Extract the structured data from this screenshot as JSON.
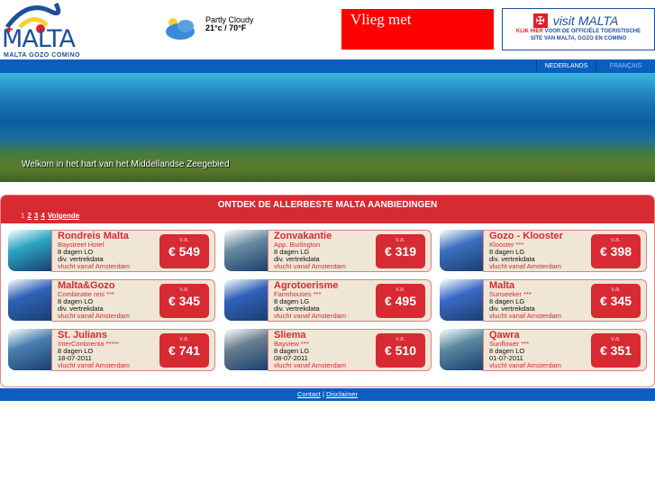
{
  "logo": {
    "word": "MALTA",
    "sub": "MALTA GOZO COMINO"
  },
  "weather": {
    "condition": "Partly Cloudy",
    "temp": "21°c / 70°F"
  },
  "ad": {
    "text": "Vlieg met"
  },
  "visit": {
    "title": "visit MALTA",
    "line1_red": "KLIK HIER",
    "line1": " VOOR DE OFFICIËLE TOERISTISCHE",
    "line2": "SITE VAN MALTA, GOZO EN COMINO"
  },
  "nav": {
    "lang1": "NEDERLANDS",
    "lang2": "FRANÇAIS"
  },
  "hero": {
    "caption": "Welkom in het hart van het Middellandse Zeegebied"
  },
  "panel": {
    "title": "ONTDEK DE ALLERBESTE MALTA AANBIEDINGEN",
    "pager": [
      "1",
      "2",
      "3",
      "4"
    ],
    "next": "Volgende"
  },
  "offers": [
    {
      "title": "Rondreis Malta",
      "hotel": "Baystreet Hotel",
      "l1": "8 dagen LO",
      "l2": "div. vertrekdata",
      "flight": "vlucht vanaf Amsterdam",
      "va": "v.a.",
      "price": "€ 549",
      "img": "#2aa6c4"
    },
    {
      "title": "Zonvakantie",
      "hotel": "App. Burlington",
      "l1": "8 dagen LG",
      "l2": "div. vertrekdata",
      "flight": "vlucht vanaf Amsterdam",
      "va": "v.a.",
      "price": "€ 319",
      "img": "#6a8aa0"
    },
    {
      "title": "Gozo - Klooster",
      "hotel": "Klooster ***",
      "l1": "8 dagen LG",
      "l2": "div. vertrekdata",
      "flight": "vlucht vanaf Amsterdam",
      "va": "v.a.",
      "price": "€ 398",
      "img": "#3a70c0"
    },
    {
      "title": "Malta&Gozo",
      "hotel": "Combinatie reis ***",
      "l1": "8 dagen LO",
      "l2": "div. vertrekdata",
      "flight": "vlucht vanaf Amsterdam",
      "va": "v.a.",
      "price": "€ 345",
      "img": "#2f62b8"
    },
    {
      "title": "Agrotoerisme",
      "hotel": "Farmhouses ***",
      "l1": "8 dagen LG",
      "l2": "div. vertrekdata",
      "flight": "vlucht vanaf Amsterdam",
      "va": "v.a.",
      "price": "€ 495",
      "img": "#2f62b8"
    },
    {
      "title": "Malta",
      "hotel": "Sunseeker ***",
      "l1": "8 dagen LG",
      "l2": "div. vertrekdata",
      "flight": "vlucht vanaf Amsterdam",
      "va": "v.a.",
      "price": "€ 345",
      "img": "#3a6ac8"
    },
    {
      "title": "St. Julians",
      "hotel": "InterContinenta *****",
      "l1": "8 dagen LO",
      "l2": "18-07-2011",
      "flight": "vlucht vanaf Amsterdam",
      "va": "v.a.",
      "price": "€ 741",
      "img": "#4a7fb0"
    },
    {
      "title": "Sliema",
      "hotel": "Bayview ***",
      "l1": "8 dagen LG",
      "l2": "08-07-2011",
      "flight": "vlucht vanaf Amsterdam",
      "va": "v.a.",
      "price": "€ 510",
      "img": "#6a7f90"
    },
    {
      "title": "Qawra",
      "hotel": "Sunflower ***",
      "l1": "8 dagen LO",
      "l2": "01-07-2011",
      "flight": "vlucht vanaf Amsterdam",
      "va": "v.a.",
      "price": "€ 351",
      "img": "#5a8aa0"
    }
  ],
  "footer": {
    "contact": "Contact",
    "sep": " | ",
    "disclaimer": "Disclaimer"
  }
}
